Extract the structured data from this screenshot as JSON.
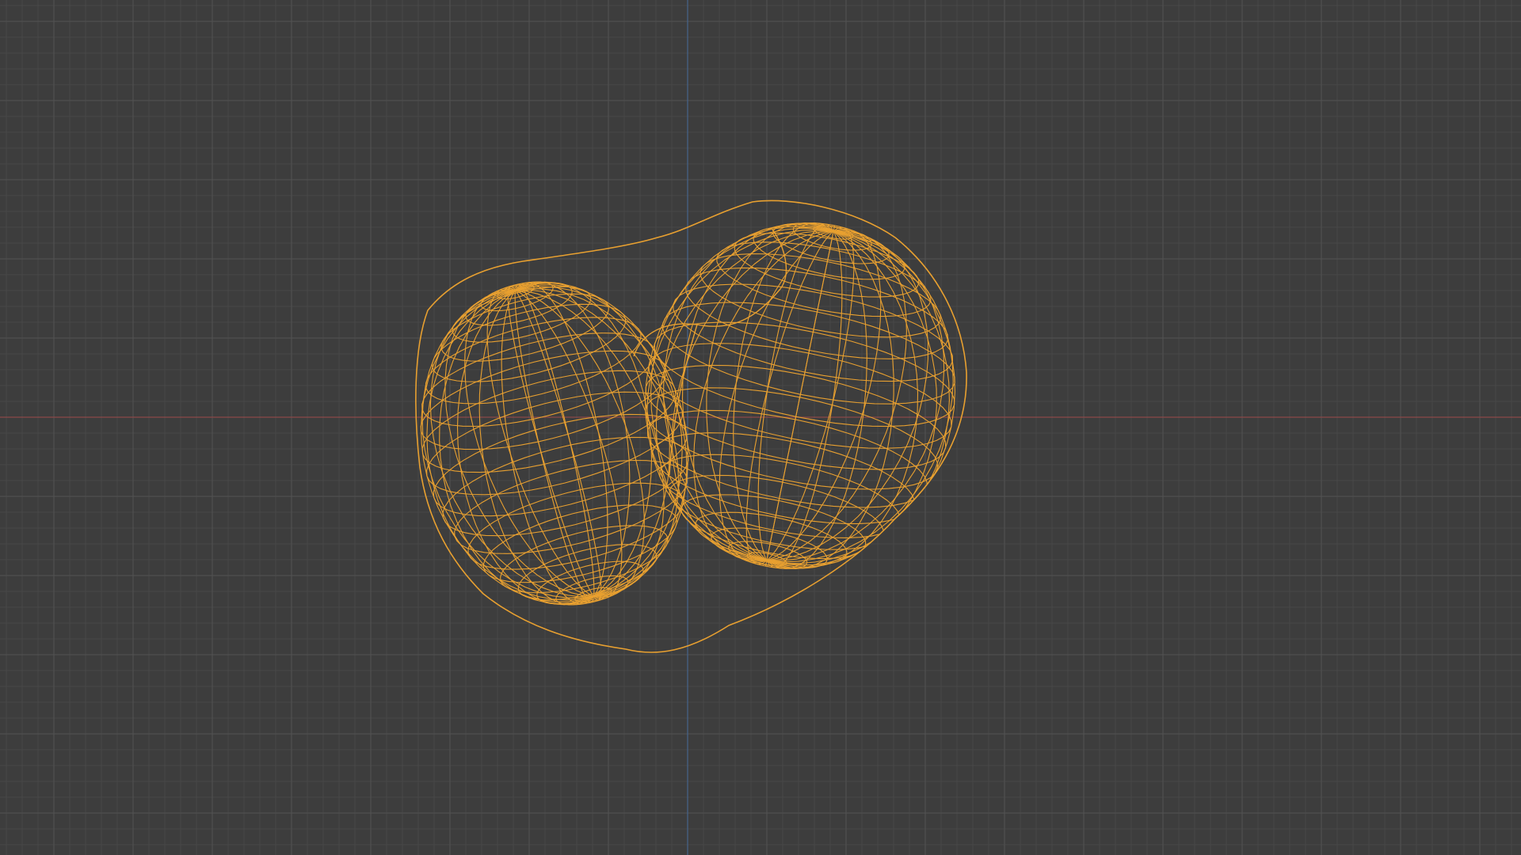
{
  "viewport": {
    "view": "3d-viewport-wireframe",
    "background_color": "#3d3d3d",
    "grid": {
      "visible": true,
      "minor_line_color": "#484848",
      "major_line_color": "#525252"
    },
    "axes": {
      "x_axis_color": "#8a4a4a",
      "z_axis_color": "#46648c"
    },
    "object": {
      "shading": "wireframe",
      "selected": true,
      "wire_color": "#e8a030"
    }
  }
}
